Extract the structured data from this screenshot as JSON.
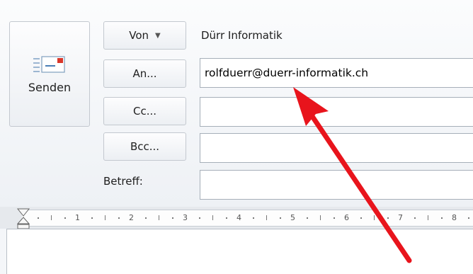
{
  "send_button": {
    "label": "Senden",
    "icon": "envelope-send-icon"
  },
  "fields": {
    "from": {
      "label": "Von",
      "value": "Dürr Informatik",
      "icon": "dropdown-caret-icon"
    },
    "to": {
      "label": "An...",
      "value": "rolfduerr@duerr-informatik.ch"
    },
    "cc": {
      "label": "Cc...",
      "value": ""
    },
    "bcc": {
      "label": "Bcc...",
      "value": ""
    },
    "subject": {
      "label": "Betreff:",
      "value": ""
    }
  },
  "ruler": {
    "numbers": [
      "1",
      "2",
      "3",
      "4",
      "5",
      "6",
      "7",
      "8"
    ]
  },
  "annotation": {
    "icon": "red-arrow-icon",
    "color": "#e8141c"
  }
}
